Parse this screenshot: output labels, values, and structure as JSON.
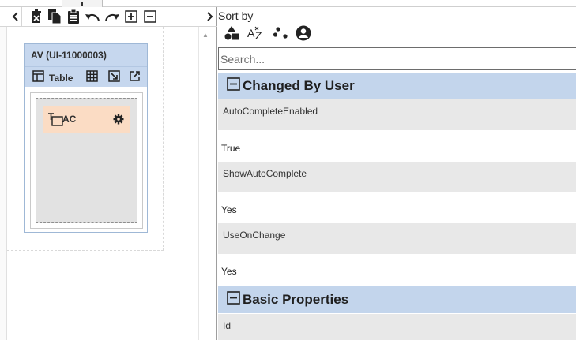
{
  "designer": {
    "av_title": "AV (UI-11000003)",
    "av_view_label": "Table",
    "ac_label": "AC"
  },
  "properties": {
    "sort_label": "Sort by",
    "search_placeholder": "Search...",
    "groups": [
      {
        "title": "Changed By User",
        "items": [
          {
            "name": "AutoCompleteEnabled",
            "value": "True"
          },
          {
            "name": "ShowAutoComplete",
            "value": "Yes"
          },
          {
            "name": "UseOnChange",
            "value": "Yes"
          }
        ]
      },
      {
        "title": "Basic Properties",
        "items": [
          {
            "name": "Id",
            "value": ""
          }
        ]
      }
    ]
  },
  "colors": {
    "group_header": "#c3d5ec",
    "card_header": "#c6d7ee",
    "ac_item": "#fbdcc4",
    "prop_name_bg": "#e8e8e8"
  },
  "icons": [
    "chevron-left-icon",
    "delete-icon",
    "copy-icon",
    "paste-icon",
    "undo-icon",
    "redo-icon",
    "expand-icon",
    "collapse-icon",
    "chevron-right-icon",
    "table-icon",
    "grid-icon",
    "shrink-icon",
    "open-external-icon",
    "textbox-icon",
    "gear-icon",
    "sort-category-icon",
    "sort-alpha-icon",
    "sort-scatter-icon",
    "sort-user-icon"
  ]
}
